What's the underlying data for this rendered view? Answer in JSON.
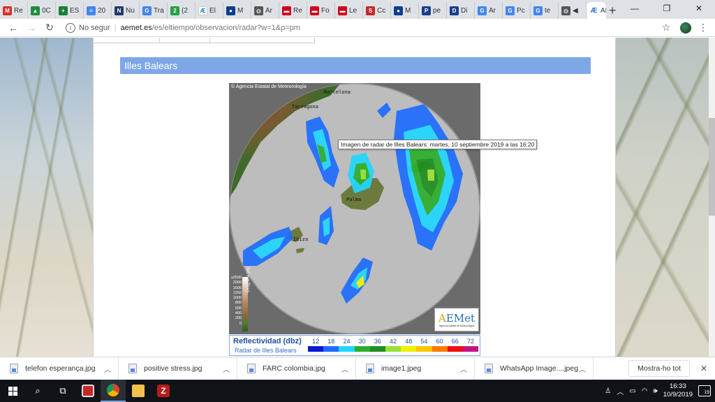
{
  "tabs": [
    {
      "label": "Re",
      "color": "#d93025",
      "icon": "gmail-icon",
      "glyph": "M"
    },
    {
      "label": "0C",
      "color": "#1e8e3e",
      "icon": "drive-icon",
      "glyph": "▲"
    },
    {
      "label": "ES",
      "color": "#188038",
      "icon": "sheets-icon",
      "glyph": "+"
    },
    {
      "label": "20",
      "color": "#4285f4",
      "icon": "docs-icon",
      "glyph": "≡"
    },
    {
      "label": "Nu",
      "color": "#203a6b",
      "icon": "news-icon",
      "glyph": "N"
    },
    {
      "label": "Tra",
      "color": "#4285f4",
      "icon": "translate-icon",
      "glyph": "G"
    },
    {
      "label": "(2",
      "color": "#25a244",
      "icon": "whatsapp-icon",
      "glyph": "2"
    },
    {
      "label": "El",
      "color": "#ffffff",
      "icon": "aemet-icon",
      "glyph": "Æ"
    },
    {
      "label": "M",
      "color": "#0b3d91",
      "icon": "site-icon",
      "glyph": "●"
    },
    {
      "label": "Ar",
      "color": "#555555",
      "icon": "globe-icon",
      "glyph": "◍"
    },
    {
      "label": "Re",
      "color": "#d0021b",
      "icon": "flag-icon",
      "glyph": "▬"
    },
    {
      "label": "Fo",
      "color": "#d0021b",
      "icon": "flag-icon",
      "glyph": "▬"
    },
    {
      "label": "Le",
      "color": "#d0021b",
      "icon": "flag-icon",
      "glyph": "▬"
    },
    {
      "label": "Cc",
      "color": "#c62828",
      "icon": "cc-icon",
      "glyph": "S"
    },
    {
      "label": "M",
      "color": "#0b3d91",
      "icon": "site-icon",
      "glyph": "●"
    },
    {
      "label": "pe",
      "color": "#1a3f8a",
      "icon": "p-icon",
      "glyph": "P"
    },
    {
      "label": "Di",
      "color": "#1a3f8a",
      "icon": "dictionary-icon",
      "glyph": "D"
    },
    {
      "label": "Ar",
      "color": "#4285f4",
      "icon": "google-icon",
      "glyph": "G"
    },
    {
      "label": "Pc",
      "color": "#4285f4",
      "icon": "google-icon",
      "glyph": "G"
    },
    {
      "label": "te",
      "color": "#4285f4",
      "icon": "google-icon",
      "glyph": "G"
    },
    {
      "label": "◀",
      "color": "#555555",
      "icon": "globe-icon",
      "glyph": "◍"
    }
  ],
  "active_tab": {
    "label": "AE",
    "color": "#ffffff",
    "icon": "aemet-icon",
    "glyph": "Æ"
  },
  "toolbar": {
    "security": "No segur",
    "url_host": "aemet.es",
    "url_path": "/es/eltiempo/observacion/radar?w=1&p=pm"
  },
  "page": {
    "section_title": "Illes Balears",
    "radar_copyright": "© Agencia Estatal de Meteorología",
    "cities": [
      {
        "name": "Barcelona"
      },
      {
        "name": "Tarragona"
      },
      {
        "name": "Palma"
      },
      {
        "name": "Ibiza"
      }
    ],
    "orography": {
      "title": "Orografía (m)",
      "levels": [
        "≥2500",
        "2000",
        "1500",
        "1250",
        "1000",
        "800",
        "600",
        "400",
        "200",
        "0"
      ]
    },
    "logo": {
      "mark_a": "A",
      "mark_rest": "EMet",
      "sub": "Agencia Estatal de Meteorología"
    },
    "legend": {
      "title": "Reflectividad (dbz)",
      "subtitle": "Radar de Illes Balears",
      "values": [
        "12",
        "18",
        "24",
        "30",
        "36",
        "42",
        "48",
        "54",
        "60",
        "66",
        "72"
      ],
      "colors": [
        "#0a1ad1",
        "#1e6cff",
        "#20d6ff",
        "#2cae2c",
        "#1f8f1f",
        "#9be035",
        "#f0f000",
        "#ffc400",
        "#ff7a00",
        "#ee1010",
        "#c41480"
      ]
    },
    "tooltip": "Imagen de radar de Illes Balears: martes, 10 septiembre 2019 a las 16:20"
  },
  "downloads": [
    {
      "name": "telefon esperança.jpg"
    },
    {
      "name": "positive stress.jpg"
    },
    {
      "name": "FARC colombia.jpg"
    },
    {
      "name": "image1.jpeg"
    },
    {
      "name": "WhatsApp Image....jpeg"
    }
  ],
  "shelf": {
    "show_all": "Mostra-ho tot"
  },
  "taskbar": {
    "time": "16:33",
    "date": "10/9/2019",
    "notifications": "19"
  }
}
